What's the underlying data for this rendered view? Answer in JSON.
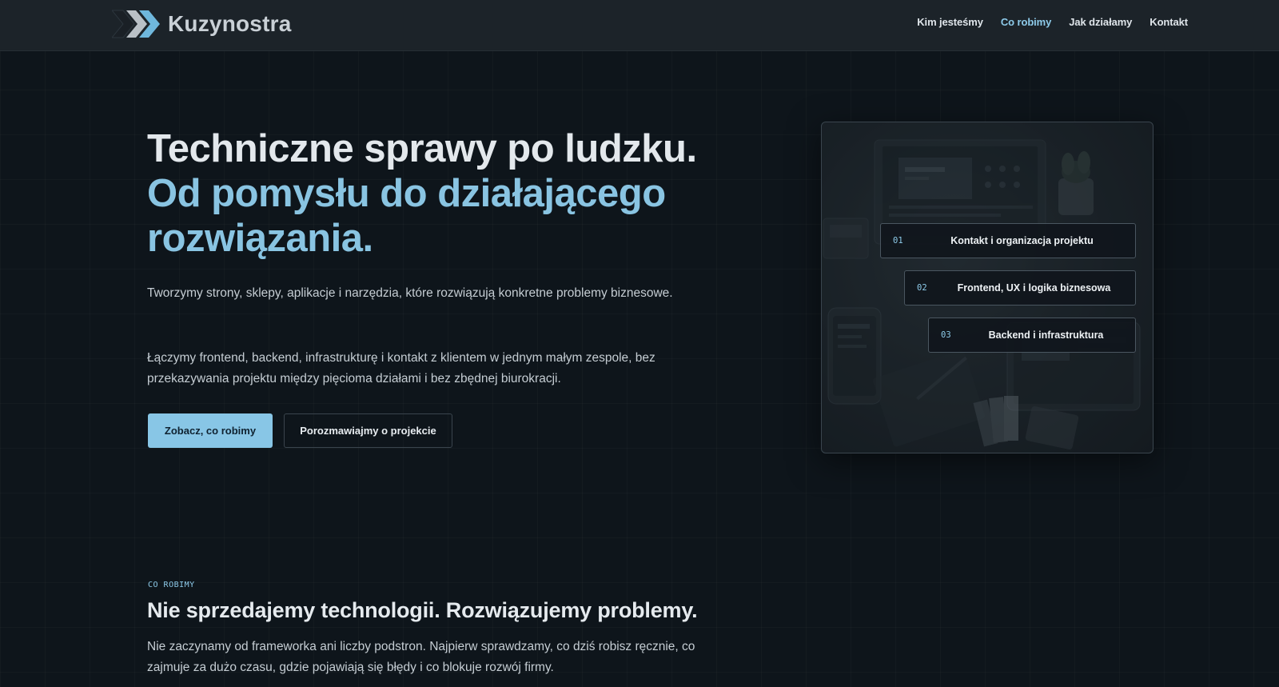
{
  "header": {
    "brand": "Kuzynostra",
    "nav": [
      {
        "label": "Kim jesteśmy",
        "active": false
      },
      {
        "label": "Co robimy",
        "active": true
      },
      {
        "label": "Jak działamy",
        "active": false
      },
      {
        "label": "Kontakt",
        "active": false
      }
    ]
  },
  "hero": {
    "title_line1": "Techniczne sprawy po ludzku.",
    "title_line2": "Od pomysłu do działającego rozwiązania.",
    "paragraph1": "Tworzymy strony, sklepy, aplikacje i narzędzia, które rozwiązują konkretne problemy biznesowe.",
    "paragraph2": "Łączymy frontend, backend, infrastrukturę i kontakt z klientem w jednym małym zespole, bez przekazywania projektu między pięcioma działami i bez zbędnej biurokracji.",
    "primary_button": "Zobacz, co robimy",
    "secondary_button": "Porozmawiajmy o projekcie",
    "steps": [
      {
        "num": "01",
        "label": "Kontakt i organizacja projektu"
      },
      {
        "num": "02",
        "label": "Frontend, UX i logika biznesowa"
      },
      {
        "num": "03",
        "label": "Backend i infrastruktura"
      }
    ]
  },
  "section": {
    "eyebrow": "CO ROBIMY",
    "title": "Nie sprzedajemy technologii. Rozwiązujemy problemy.",
    "paragraph": "Nie zaczynamy od frameworka ani liczby podstron. Najpierw sprawdzamy, co dziś robisz ręcznie, co zajmuje za dużo czasu, gdzie pojawiają się błędy i co blokuje rozwój firmy."
  },
  "colors": {
    "accent": "#89c4e2",
    "background": "#0e151b",
    "header": "#1c2329"
  }
}
